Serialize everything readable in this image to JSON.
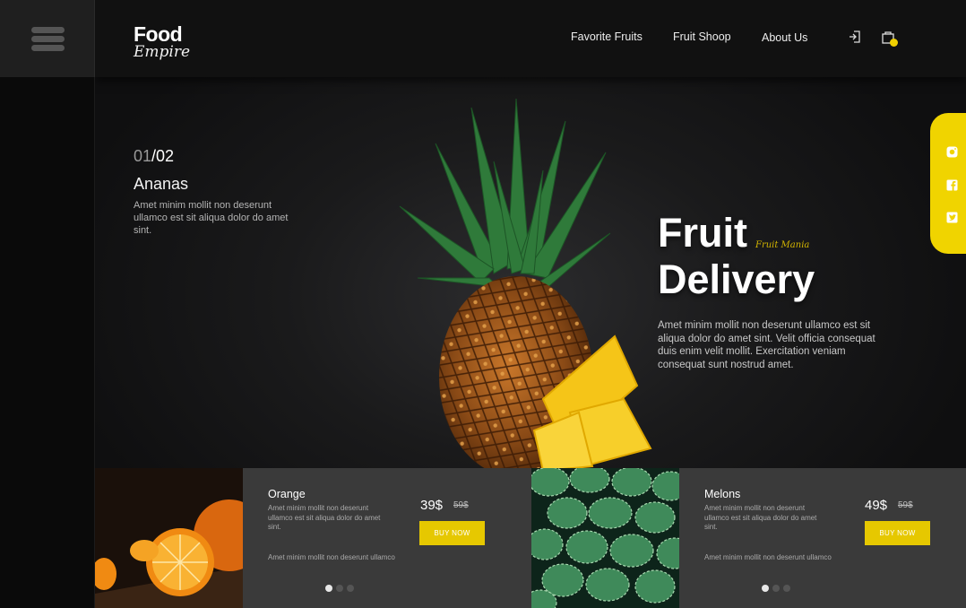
{
  "sidebar": {
    "menu_icon": "hamburger-menu-icon"
  },
  "header": {
    "logo_top": "Food",
    "logo_script": "Empire",
    "nav": [
      "Favorite Fruits",
      "Fruit Shoop",
      "About Us"
    ],
    "icons": [
      "login-icon",
      "shopping-bag-icon"
    ],
    "accent": "#f0d000"
  },
  "hero": {
    "counter_current": "01",
    "counter_total": "/02",
    "product_name": "Ananas",
    "product_desc": "Amet minim mollit non deserunt ullamco est sit aliqua dolor do amet sint.",
    "title_line1": "Fruit",
    "title_line2": "Delivery",
    "script": "Fruit Mania",
    "desc": "Amet minim mollit non deserunt ullamco est sit aliqua dolor do amet sint. Velit officia consequat duis enim velit mollit. Exercitation veniam consequat sunt nostrud amet."
  },
  "social": {
    "icons": [
      "instagram-icon",
      "facebook-icon",
      "twitter-icon"
    ]
  },
  "cards": [
    {
      "name": "Orange",
      "desc": "Amet minim mollit non deserunt ullamco est sit aliqua dolor do amet sint.",
      "price": "39$",
      "old_price": "59$",
      "button": "BUY NOW",
      "footer": "Amet minim mollit non deserunt ullamco"
    },
    {
      "name": "Melons",
      "desc": "Amet minim mollit non deserunt ullamco est sit aliqua dolor do amet sint.",
      "price": "49$",
      "old_price": "59$",
      "button": "BUY NOW",
      "footer": "Amet minim mollit non deserunt ullamco"
    }
  ],
  "colors": {
    "button": "#e6c800",
    "social_bg": "#f0d400",
    "card_bg": "#3a3a3a"
  }
}
